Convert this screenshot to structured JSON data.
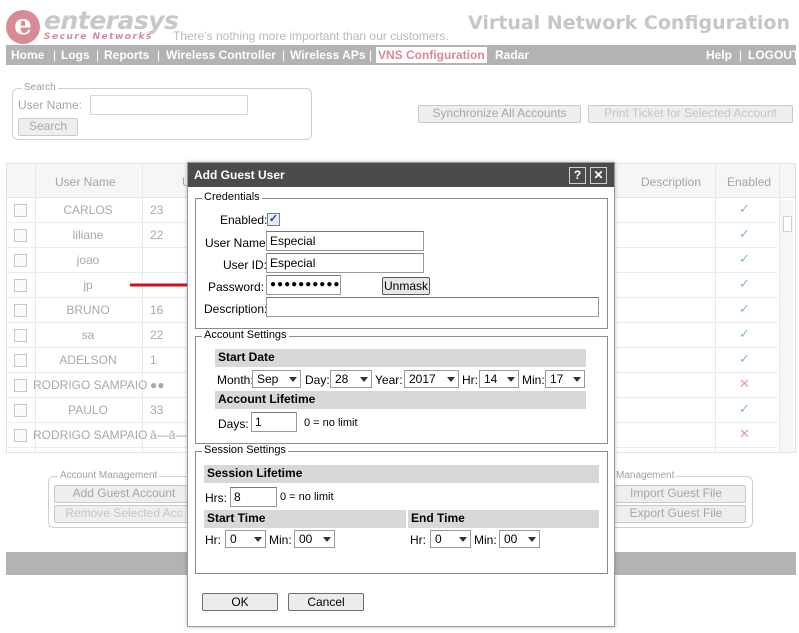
{
  "header": {
    "logo_letter": "e",
    "logo_name": "enterasys",
    "logo_sub": "Secure Networks",
    "tagline": "There's nothing more important than our customers.",
    "app_title": "Virtual Network Configuration"
  },
  "nav": {
    "items": [
      "Home",
      "Logs",
      "Reports",
      "Wireless Controller",
      "Wireless APs",
      "VNS Configuration",
      "Radar"
    ],
    "active": "VNS Configuration",
    "right_items": [
      "Help",
      "LOGOUT"
    ],
    "separator": "|"
  },
  "search": {
    "legend": "Search",
    "user_name_label": "User Name:",
    "user_name_value": "",
    "search_button": "Search"
  },
  "actions": {
    "sync_all": "Synchronize All Accounts",
    "print_ticket": "Print Ticket for Selected Account"
  },
  "grid": {
    "headers": {
      "user_name": "User Name",
      "user_id": "U",
      "description": "Description",
      "enabled": "Enabled"
    },
    "rows": [
      {
        "user_name": "CARLOS",
        "user_id": "23",
        "enabled": "✓",
        "enabled_state": "yes"
      },
      {
        "user_name": "liliane",
        "user_id": "22",
        "enabled": "✓",
        "enabled_state": "yes"
      },
      {
        "user_name": "joao",
        "user_id": "",
        "enabled": "✓",
        "enabled_state": "yes"
      },
      {
        "user_name": "jp",
        "user_id": "",
        "enabled": "✓",
        "enabled_state": "yes"
      },
      {
        "user_name": "BRUNO",
        "user_id": "16",
        "enabled": "✓",
        "enabled_state": "yes"
      },
      {
        "user_name": "sa",
        "user_id": "22",
        "enabled": "✓",
        "enabled_state": "yes"
      },
      {
        "user_name": "ADELSON",
        "user_id": "1",
        "enabled": "✓",
        "enabled_state": "yes"
      },
      {
        "user_name": "RODRIGO SAMPAIO",
        "user_id": "●●",
        "enabled": "✕",
        "enabled_state": "no"
      },
      {
        "user_name": "PAULO",
        "user_id": "33",
        "enabled": "✓",
        "enabled_state": "yes"
      },
      {
        "user_name": "RODRIGO SAMPAIO",
        "user_id": "â—â—",
        "enabled": "✕",
        "enabled_state": "no"
      }
    ]
  },
  "account_management": {
    "legend": "Account Management",
    "add_guest": "Add Guest Account",
    "remove_selected": "Remove Selected Acc",
    "legend_right": "Management",
    "import_guest": "Import Guest File",
    "export_guest": "Export Guest File"
  },
  "modal": {
    "title": "Add Guest User",
    "help_icon": "?",
    "close_icon": "✕",
    "credentials": {
      "legend": "Credentials",
      "enabled_label": "Enabled:",
      "enabled_checked": "✓",
      "user_name_label": "User Name:",
      "user_name_value": "Especial",
      "user_id_label": "User ID:",
      "user_id_value": "Especial",
      "password_label": "Password:",
      "password_value": "●●●●●●●●●●",
      "unmask_button": "Unmask",
      "description_label": "Description:",
      "description_value": ""
    },
    "account_settings": {
      "legend": "Account Settings",
      "start_date_heading": "Start Date",
      "month_label": "Month:",
      "month_value": "Sep",
      "day_label": "Day:",
      "day_value": "28",
      "year_label": "Year:",
      "year_value": "2017",
      "hr_label": "Hr:",
      "hr_value": "14",
      "min_label": "Min:",
      "min_value": "17",
      "lifetime_heading": "Account Lifetime",
      "days_label": "Days:",
      "days_value": "1",
      "days_hint": "0 = no limit"
    },
    "session_settings": {
      "legend": "Session Settings",
      "lifetime_heading": "Session Lifetime",
      "hrs_label": "Hrs:",
      "hrs_value": "8",
      "hrs_hint": "0 = no limit",
      "start_time_heading": "Start Time",
      "start_hr_label": "Hr:",
      "start_hr_value": "0",
      "start_min_label": "Min:",
      "start_min_value": "00",
      "end_time_heading": "End Time",
      "end_hr_label": "Hr:",
      "end_hr_value": "0",
      "end_min_label": "Min:",
      "end_min_value": "00"
    },
    "ok_button": "OK",
    "cancel_button": "Cancel"
  },
  "colors": {
    "brand_pink": "#d98a97",
    "nav_gray": "#b3b3b3",
    "title_bar": "#4b4b4b",
    "annotation_arrow": "#c8151b"
  }
}
